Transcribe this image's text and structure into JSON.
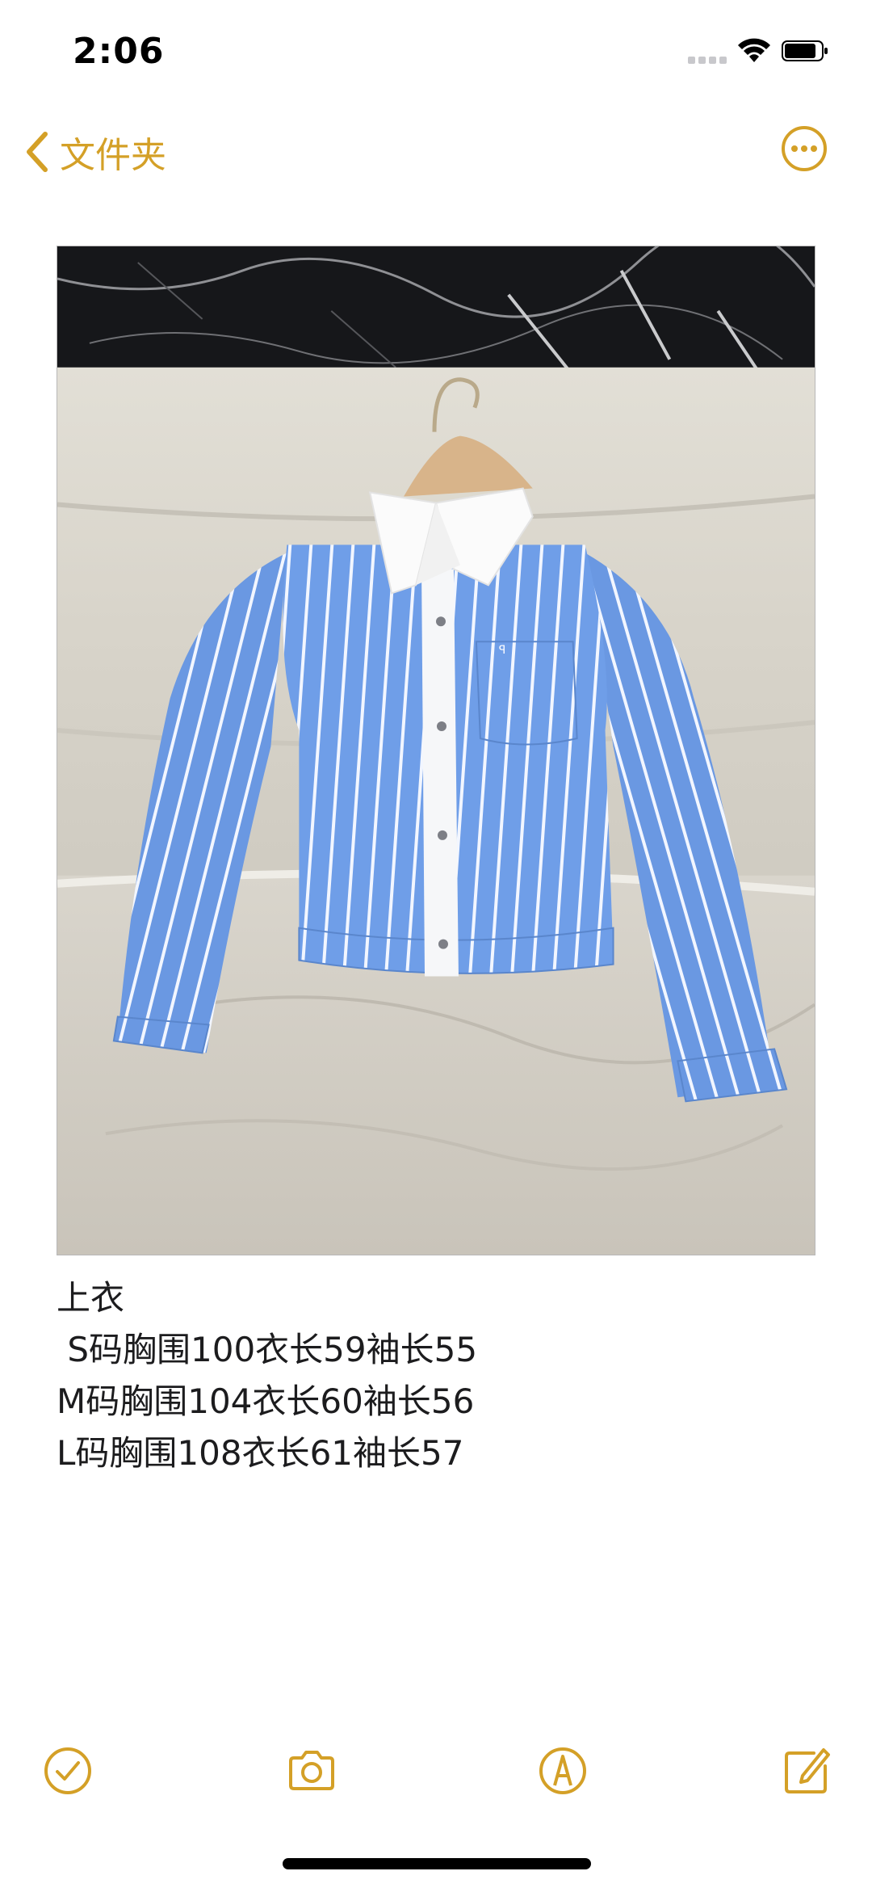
{
  "status_bar": {
    "time": "2:06"
  },
  "nav": {
    "back_label": "文件夹"
  },
  "note": {
    "lines": [
      "上衣",
      " S码胸围100衣长59袖长55",
      "M码胸围104衣长60袖长56",
      "L码胸围108衣长61袖长57"
    ]
  },
  "colors": {
    "accent": "#d4a027",
    "shirt_blue": "#6f9ee8",
    "stripe": "#ffffff"
  },
  "toolbar": {
    "icons": [
      "checklist-icon",
      "camera-icon",
      "markup-icon",
      "compose-icon"
    ]
  }
}
